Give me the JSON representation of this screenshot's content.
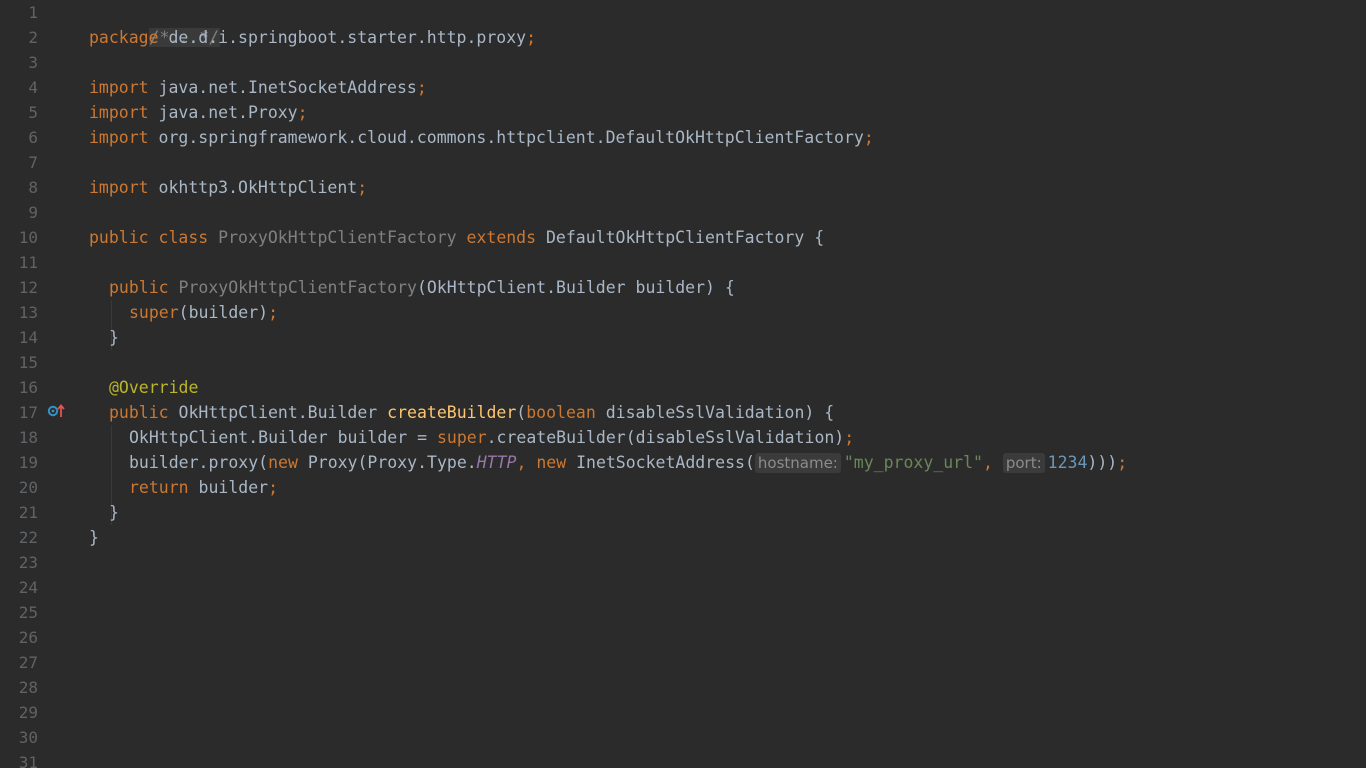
{
  "gutter": {
    "line_numbers": [
      "1",
      "2",
      "3",
      "4",
      "5",
      "6",
      "7",
      "8",
      "9",
      "10",
      "11",
      "12",
      "13",
      "14",
      "15",
      "16",
      "17",
      "18",
      "19",
      "20",
      "21",
      "22",
      "23",
      "24",
      "25",
      "26",
      "27",
      "28",
      "29",
      "30",
      "31"
    ]
  },
  "code": {
    "l1_folded": "/*...*/",
    "l2_kw": "package",
    "l2_pkg": " de.d.i.springboot.starter.http.proxy",
    "l4_kw": "import",
    "l4_name": " java.net.InetSocketAddress",
    "l5_kw": "import",
    "l5_name": " java.net.Proxy",
    "l6_kw": "import",
    "l6_name": " org.springframework.cloud.commons.httpclient.DefaultOkHttpClientFactory",
    "l8_kw": "import",
    "l8_name": " okhttp3.OkHttpClient",
    "l10_kw1": "public",
    "l10_kw2": "class",
    "l10_cls": "ProxyOkHttpClientFactory",
    "l10_kw3": "extends",
    "l10_parent": " DefaultOkHttpClientFactory {",
    "l12_kw": "public",
    "l12_ctor": "ProxyOkHttpClientFactory",
    "l12_rest": "(OkHttpClient.Builder builder) {",
    "l13_kw": "super",
    "l13_rest": "(builder)",
    "l14": "}",
    "l16_ann": "@Override",
    "l17_kw": "public",
    "l17_type": " OkHttpClient.Builder ",
    "l17_method": "createBuilder",
    "l17_open": "(",
    "l17_kw2": "boolean",
    "l17_rest": " disableSslValidation) {",
    "l18_a": "OkHttpClient.Builder builder = ",
    "l18_kw": "super",
    "l18_b": ".createBuilder(disableSslValidation)",
    "l19_a": "builder.proxy(",
    "l19_kw1": "new",
    "l19_b": " Proxy(Proxy.Type.",
    "l19_field": "HTTP",
    "l19_kw2": "new",
    "l19_c": " InetSocketAddress(",
    "l19_hint1": "hostname:",
    "l19_str": "\"my_proxy_url\"",
    "l19_hint2": "port:",
    "l19_num": "1234",
    "l19_close": ")))",
    "l20_kw": "return",
    "l20_rest": " builder",
    "l21": "}",
    "l22": "}",
    "semicolon": ";",
    "comma": ",",
    "space": " "
  },
  "colors": {
    "background": "#2b2b2b",
    "keyword": "#cc7832",
    "annotation": "#bbb529",
    "method": "#ffc66d",
    "string": "#6a8759",
    "number": "#6897bb",
    "field": "#9876aa"
  },
  "icons": {
    "gutter_line_17": "override-method-icon"
  }
}
